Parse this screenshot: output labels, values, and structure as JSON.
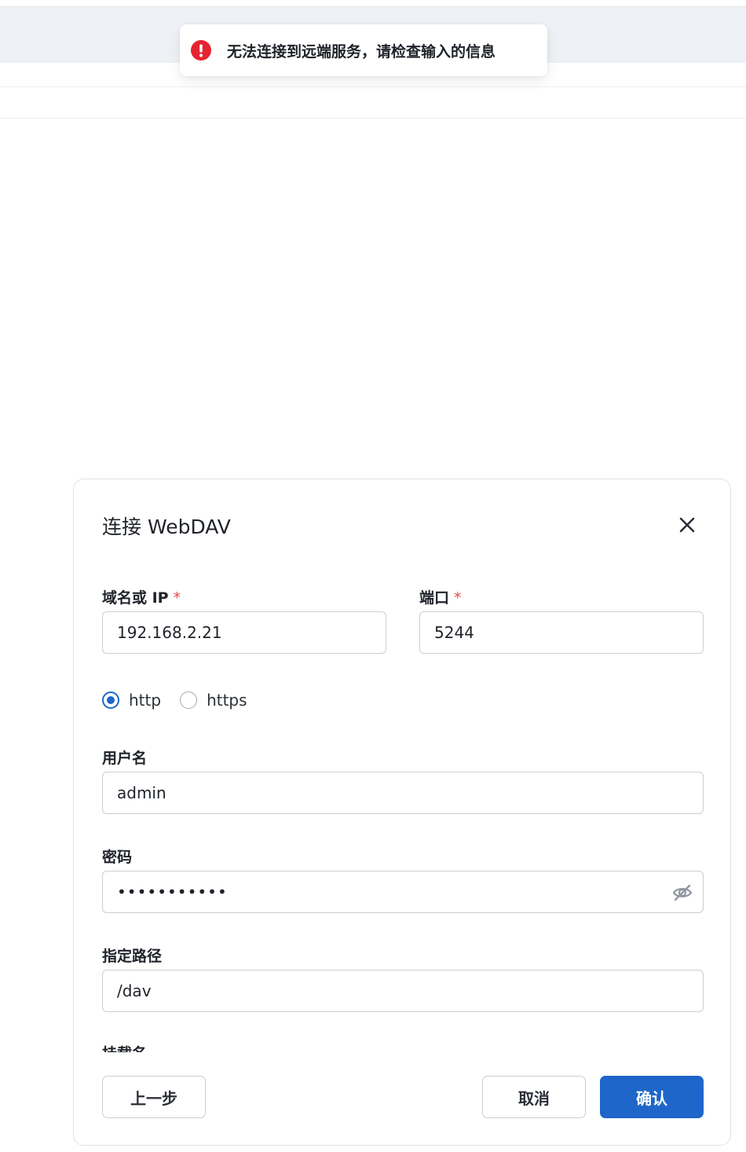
{
  "toast": {
    "message": "无法连接到远端服务，请检查输入的信息",
    "icon": "error-circle-icon",
    "icon_color": "#e5242f"
  },
  "dialog": {
    "title": "连接 WebDAV",
    "close_icon": "close-icon",
    "fields": {
      "host": {
        "label": "域名或 IP",
        "required_mark": "*",
        "value": "192.168.2.21"
      },
      "port": {
        "label": "端口",
        "required_mark": "*",
        "value": "5244"
      },
      "username": {
        "label": "用户名",
        "value": "admin"
      },
      "password": {
        "label": "密码",
        "value": "•••••••••••",
        "toggle_icon": "eye-off-icon"
      },
      "path": {
        "label": "指定路径",
        "value": "/dav"
      },
      "mount_name": {
        "label": "挂载名"
      }
    },
    "protocol": {
      "options": [
        "http",
        "https"
      ],
      "selected": "http"
    },
    "buttons": {
      "back": "上一步",
      "cancel": "取消",
      "confirm": "确认"
    }
  },
  "colors": {
    "accent": "#1e66c9",
    "required": "#e5484d",
    "error": "#e5242f"
  }
}
